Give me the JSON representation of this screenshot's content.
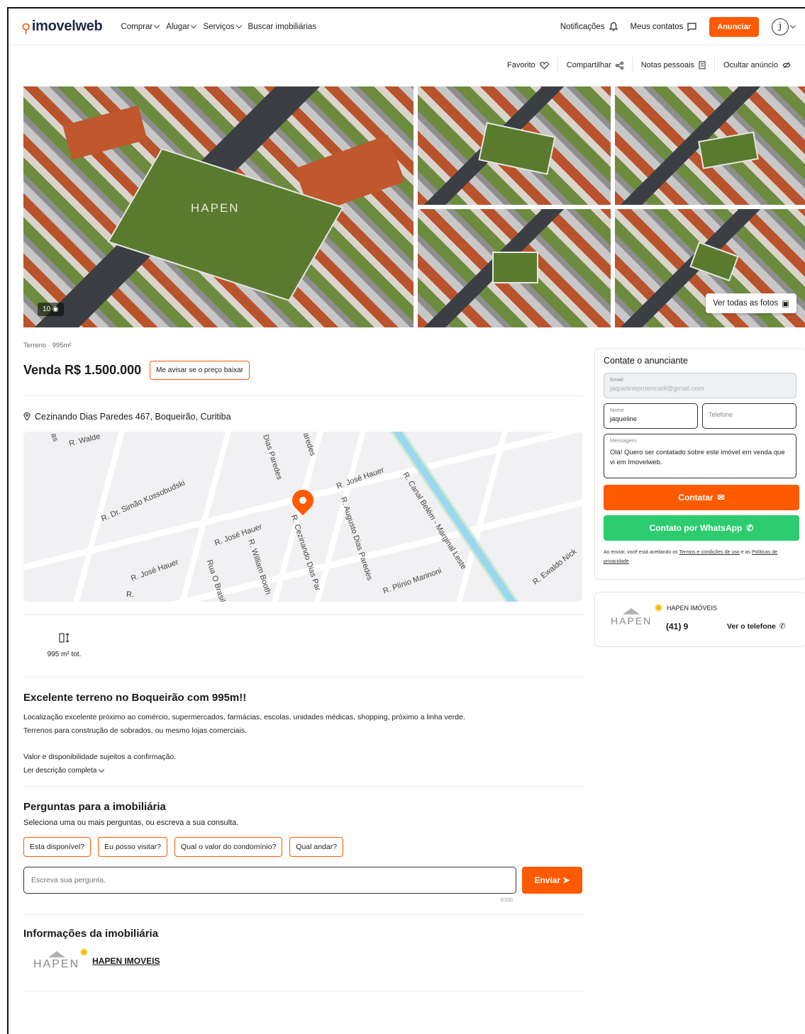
{
  "header": {
    "logo": "imovelweb",
    "nav": [
      "Comprar",
      "Alugar",
      "Serviços",
      "Buscar imobiliárias"
    ],
    "notifications": "Notificações",
    "contacts": "Meus contatos",
    "anunciar": "Anunciar",
    "avatar_letter": "j"
  },
  "actions": [
    "Favorito",
    "Compartilhar",
    "Notas pessoais",
    "Ocultar anúncio"
  ],
  "gallery": {
    "watermark": "HAPEN",
    "photo_count": "10",
    "all_photos": "Ver todas as fotos"
  },
  "listing": {
    "type": "Terreno · 995m²",
    "price": "Venda R$ 1.500.000",
    "price_alert": "Me avisar se o preço baixar",
    "address": "Cezinando Dias Paredes 467, Boqueirão, Curitiba"
  },
  "map": {
    "streets": [
      "R. Walde",
      "R. Dr. Simão Kossobudski",
      "Dias Paredes",
      "aredes",
      "R. José Hauer",
      "R. José Hauer",
      "R. José Hauer",
      "R. William Booth",
      "Rua O Brasil",
      "R. Cezinando Dias Par",
      "R. Augusto Dias Paredes",
      "R. Canal Belém - Marginal Leste",
      "R. Plínio Marinoni",
      "R. Ewaldo Nick",
      "as",
      "R."
    ]
  },
  "features": {
    "area": "995 m² tot."
  },
  "description": {
    "title": "Excelente terreno no Boqueirão com 995m!!",
    "line1": "Localização excelente próximo ao comércio, supermercados, farmácias, escolas, unidades médicas, shopping, próximo a linha verde.",
    "line2": "Terrenos para construção de sobrados, ou mesmo lojas comerciais.",
    "line3": "Valor e disponibilidade sujeitos a confirmação.",
    "read_more": "Ler descrição completa"
  },
  "questions": {
    "title": "Perguntas para a imobiliária",
    "subtitle": "Seleciona uma ou mais perguntas, ou escreva a sua consulta.",
    "chips": [
      "Esta disponível?",
      "Eu posso visitar?",
      "Qual o valor do condomínio?",
      "Qual andar?"
    ],
    "placeholder": "Escreva sua pergunta.",
    "send": "Enviar",
    "counter": "0/200"
  },
  "agency_info": {
    "title": "Informações da imobiliária",
    "name": "HAPEN IMOVEIS",
    "logo_text": "HAPEN"
  },
  "contact_form": {
    "title": "Contate o anunciante",
    "email_label": "Email",
    "email_value": "jaquelineproencadl@gmail.com",
    "name_label": "Nome",
    "name_value": "jaqueline",
    "phone_label": "Telefone",
    "message_label": "Mensagem",
    "message_value": "Olá! Quero ser contatado sobre este imóvel em venda que vi em Imovelweb.",
    "contact_btn": "Contatar",
    "whatsapp_btn": "Contato por WhatsApp",
    "legal_prefix": "Ao enviar, você está aceitando os ",
    "terms": "Termos e condições de uso",
    "legal_mid": " e as ",
    "privacy": "Políticas de privacidade"
  },
  "agency_card": {
    "name": "HAPEN IMÓVEIS",
    "phone": "(41) 9",
    "view_phone": "Ver o telefone",
    "logo_text": "HAPEN"
  },
  "colors": {
    "accent": "#ff5a00",
    "whatsapp": "#2dcc70",
    "brand_dark": "#1f2a44"
  }
}
